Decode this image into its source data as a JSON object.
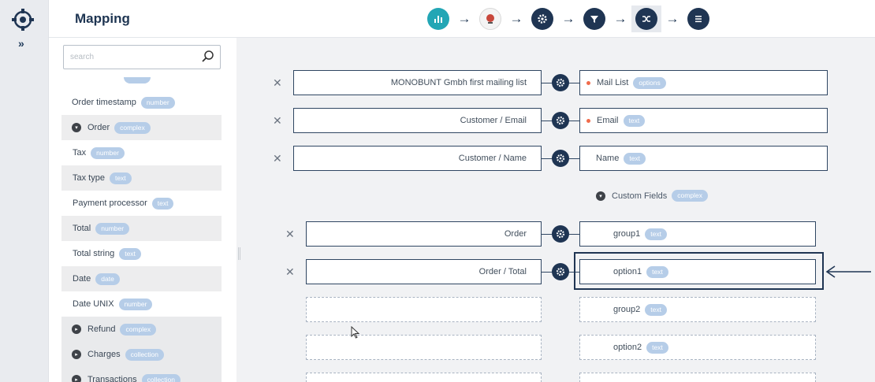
{
  "header": {
    "title": "Mapping",
    "pipeline": [
      {
        "icon": "chart-icon",
        "style": "teal"
      },
      {
        "icon": "app-logo-icon",
        "style": "logo2"
      },
      {
        "icon": "gear-icon",
        "style": "dark"
      },
      {
        "icon": "filter-icon",
        "style": "dark"
      },
      {
        "icon": "shuffle-icon",
        "style": "dark",
        "active": true
      },
      {
        "icon": "list-icon",
        "style": "dark"
      }
    ]
  },
  "rail": {
    "expand_label": "»"
  },
  "search": {
    "placeholder": "search"
  },
  "tree": {
    "order_timestamp": {
      "label": "Order timestamp",
      "type": "number"
    },
    "order": {
      "label": "Order",
      "type": "complex"
    },
    "tax": {
      "label": "Tax",
      "type": "number"
    },
    "tax_type": {
      "label": "Tax type",
      "type": "text"
    },
    "payment_processor": {
      "label": "Payment processor",
      "type": "text"
    },
    "total": {
      "label": "Total",
      "type": "number"
    },
    "total_string": {
      "label": "Total string",
      "type": "text"
    },
    "date": {
      "label": "Date",
      "type": "date"
    },
    "date_unix": {
      "label": "Date UNIX",
      "type": "number"
    },
    "refund": {
      "label": "Refund",
      "type": "complex"
    },
    "charges": {
      "label": "Charges",
      "type": "collection"
    },
    "transactions": {
      "label": "Transactions",
      "type": "collection"
    }
  },
  "mappings": {
    "m1": {
      "source": "MONOBUNT Gmbh first mailing list",
      "target": "Mail List",
      "type": "options"
    },
    "m2": {
      "source": "Customer / Email",
      "target": "Email",
      "type": "text"
    },
    "m3": {
      "source": "Customer / Name",
      "target": "Name",
      "type": "text"
    },
    "custom_fields": {
      "label": "Custom Fields",
      "type": "complex"
    },
    "m4": {
      "source": "Order",
      "target": "group1",
      "type": "text"
    },
    "m5": {
      "source": "Order / Total",
      "target": "option1",
      "type": "text"
    },
    "e1": {
      "target": "group2",
      "type": "text"
    },
    "e2": {
      "target": "option2",
      "type": "text"
    }
  },
  "remove_symbol": "✕"
}
